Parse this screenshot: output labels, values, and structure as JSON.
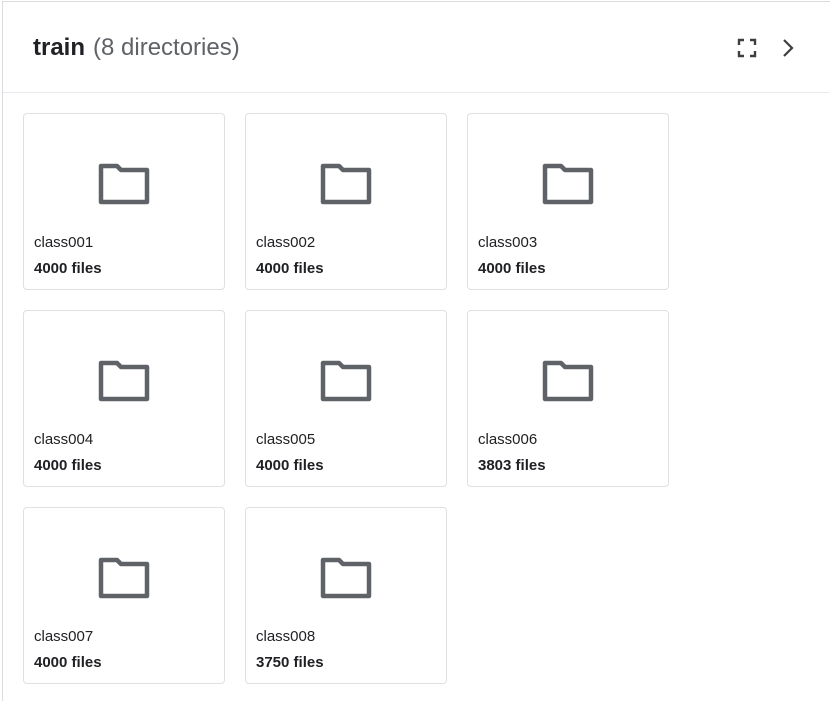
{
  "header": {
    "title": "train",
    "subtitle": "(8 directories)",
    "fullscreen_icon": "fullscreen-icon",
    "next_icon": "chevron-right-icon"
  },
  "colors": {
    "folder_icon": "#5f6368",
    "card_border": "#e0e0e0",
    "divider": "#e8eaed"
  },
  "directories": [
    {
      "name": "class001",
      "count": "4000 files"
    },
    {
      "name": "class002",
      "count": "4000 files"
    },
    {
      "name": "class003",
      "count": "4000 files"
    },
    {
      "name": "class004",
      "count": "4000 files"
    },
    {
      "name": "class005",
      "count": "4000 files"
    },
    {
      "name": "class006",
      "count": "3803 files"
    },
    {
      "name": "class007",
      "count": "4000 files"
    },
    {
      "name": "class008",
      "count": "3750 files"
    }
  ]
}
